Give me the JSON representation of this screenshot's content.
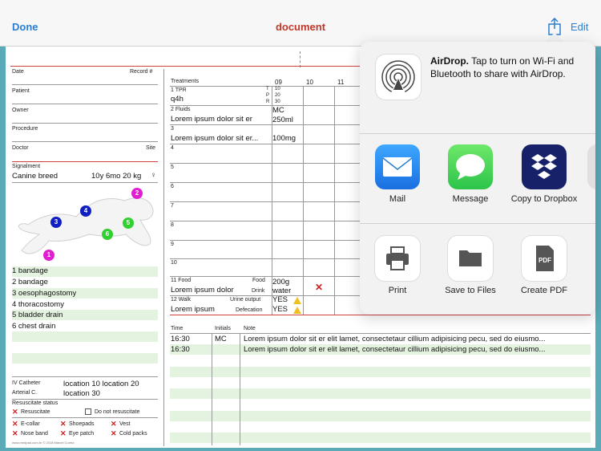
{
  "nav": {
    "done": "Done",
    "title": "document",
    "edit": "Edit"
  },
  "form": {
    "date": "Date",
    "record": "Record #",
    "patient": "Patient",
    "owner": "Owner",
    "procedure": "Procedure",
    "doctor": "Doctor",
    "site": "Site",
    "signalment_label": "Signalment",
    "breed": "Canine breed",
    "age_weight": "10y 6mo 20 kg",
    "sex_symbol": "♀",
    "markers": [
      "1",
      "2",
      "3",
      "4",
      "5",
      "6"
    ],
    "lines_list": [
      "1 bandage",
      "2 bandage",
      "3 oesophagostomy",
      "4 thoracostomy",
      "5 bladder drain",
      "6 chest drain"
    ],
    "iv_label": "IV Catheter",
    "arterial_label": "Arterial C.",
    "iv_value": "location 10 location 20",
    "arterial_value": "location 30",
    "resus_status": "Resuscitate status",
    "resuscitate": "Resuscitate",
    "do_not": "Do not resuscitate",
    "flags": [
      "E-collar",
      "Shoepads",
      "Vest",
      "Nose band",
      "Eye patch",
      "Cold packs"
    ],
    "footer": "www.medpad.com.br © 2018 Marcel Cunha"
  },
  "treatments": {
    "header": "Treatments",
    "hours": [
      "09",
      "10",
      "11"
    ],
    "r1_label": "1 TPR",
    "r1_value": "q4h",
    "tpr_letters": [
      "T",
      "P",
      "R"
    ],
    "tpr_values": [
      "10",
      "20",
      "30"
    ],
    "r2_label": "2 Fluids",
    "r2_value": "Lorem ipsum dolor sit er",
    "r2_cell_a": "MC",
    "r2_cell_b": "250ml",
    "r3_label": "3",
    "r3_value": "Lorem ipsum dolor sit er...",
    "r3_cell": "100mg",
    "row_numbers": [
      "4",
      "5",
      "6",
      "7",
      "8",
      "9",
      "10"
    ],
    "food_label": "11 Food",
    "food_tag": "Food",
    "food_value": "Lorem ipsum dolor",
    "drink_tag": "Drink",
    "food_amt": "200g",
    "drink_amt": "water",
    "walk_label": "12 Walk",
    "urine_tag": "Urine output",
    "walk_value": "Lorem ipsum",
    "def_tag": "Defecation",
    "urine_val": "YES",
    "def_val": "YES"
  },
  "notes": {
    "headers": {
      "time": "Time",
      "initials": "Initials",
      "note": "Note"
    },
    "rows": [
      {
        "time": "16:30",
        "initials": "MC",
        "note": "Lorem ipsum dolor sit er elit lamet, consectetaur cillium adipisicing pecu, sed do eiusmo..."
      },
      {
        "time": "16:30",
        "initials": "",
        "note": "Lorem ipsum dolor sit er elit lamet, consectetaur cillium adipisicing pecu, sed do eiusmo..."
      }
    ]
  },
  "share": {
    "airdrop_title": "AirDrop.",
    "airdrop_text": "Tap to turn on Wi-Fi and Bluetooth to share with AirDrop.",
    "apps": [
      {
        "label": "Mail",
        "icon": "mail-icon"
      },
      {
        "label": "Message",
        "icon": "message-icon"
      },
      {
        "label": "Copy to Dropbox",
        "icon": "dropbox-icon"
      }
    ],
    "actions": [
      {
        "label": "Print",
        "icon": "printer-icon"
      },
      {
        "label": "Save to Files",
        "icon": "folder-icon"
      },
      {
        "label": "Create PDF",
        "icon": "pdf-icon"
      }
    ],
    "pdf_badge": "PDF"
  },
  "colors": {
    "accent": "#2a7fd4",
    "title": "#c0392b",
    "magenta": "#e020d0",
    "blue": "#1020c0",
    "green": "#30d030",
    "rowgreen": "#e4f3e0"
  }
}
